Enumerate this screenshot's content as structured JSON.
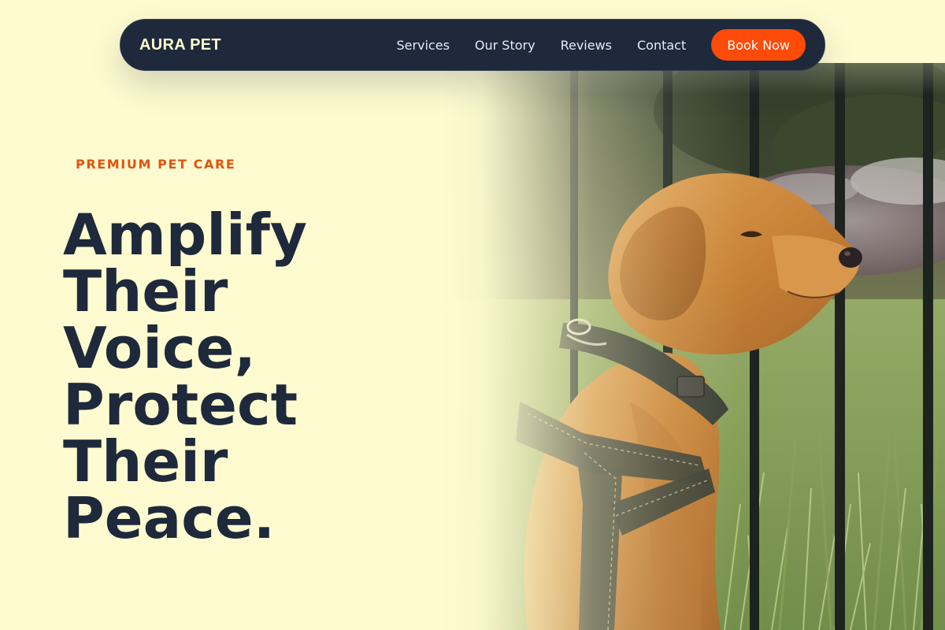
{
  "nav": {
    "brand": "AURA PET",
    "links": [
      "Services",
      "Our Story",
      "Reviews",
      "Contact"
    ],
    "cta": "Book Now"
  },
  "hero": {
    "eyebrow": "PREMIUM PET CARE",
    "headline_lines": [
      "Amplify",
      "Their",
      "Voice,",
      "Protect",
      "Their",
      "Peace."
    ],
    "image_subject": "golden labrador puppy wearing a harness beside a black iron fence"
  },
  "colors": {
    "background": "#fefbd0",
    "navy": "#1e293b",
    "accent": "#ff4b0a",
    "eyebrow": "#e2540f"
  }
}
